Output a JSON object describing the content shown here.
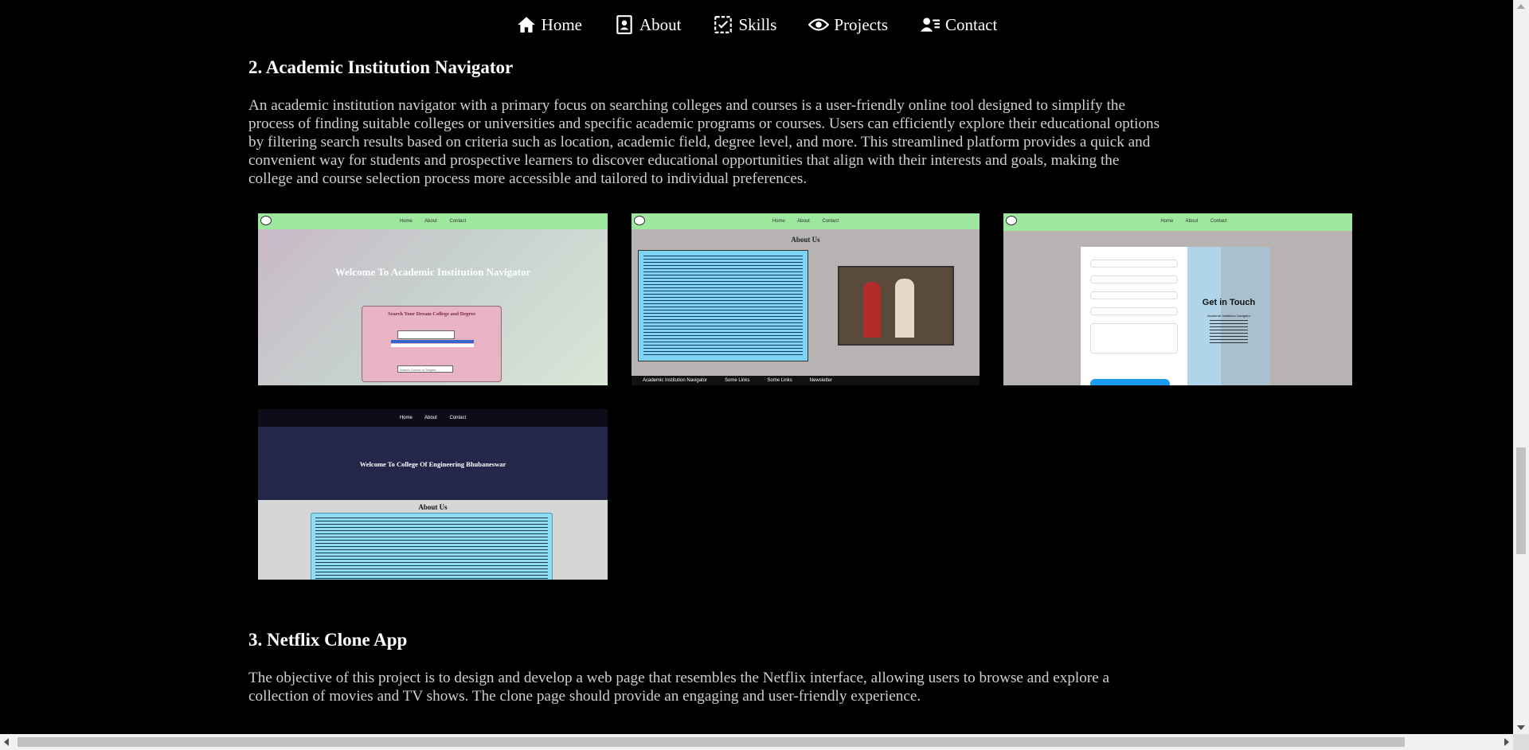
{
  "nav": {
    "items": [
      {
        "label": "Home",
        "icon": "home-icon"
      },
      {
        "label": "About",
        "icon": "contact-card-icon"
      },
      {
        "label": "Skills",
        "icon": "checklist-icon"
      },
      {
        "label": "Projects",
        "icon": "eye-icon"
      },
      {
        "label": "Contact",
        "icon": "contact-list-icon"
      }
    ]
  },
  "projects": {
    "p2": {
      "title": "2. Academic Institution Navigator",
      "description": "An academic institution navigator with a primary focus on searching colleges and courses is a user-friendly online tool designed to simplify the process of finding suitable colleges or universities and specific academic programs or courses. Users can efficiently explore their educational options by filtering search results based on criteria such as location, academic field, degree level, and more. This streamlined platform provides a quick and convenient way for students and prospective learners to discover educational opportunities that align with their interests and goals, making the college and course selection process more accessible and tailored to individual preferences.",
      "shots": {
        "s1": {
          "nav": "Home About Contact",
          "heading": "Welcome To Academic Institution Navigator",
          "search_title": "Search Your Dream College and Degree",
          "search2_placeholder": "Search Course or Degree"
        },
        "s2": {
          "nav": "Home About Contact",
          "heading": "About Us",
          "footer": [
            "Academic Institution Navigator",
            "Some Links",
            "Some Links",
            "Newsletter"
          ]
        },
        "s3": {
          "nav": "Home About Contact",
          "heading": "Get in Touch",
          "sub": "Academic Institution Navigator"
        },
        "s4": {
          "nav": "Home About Contact",
          "heading": "Welcome To College Of Engineering Bhubaneswar",
          "about": "About Us"
        }
      }
    },
    "p3": {
      "title": "3. Netflix Clone App",
      "description": "The objective of this project is to design and develop a web page that resembles the Netflix interface, allowing users to browse and explore a collection of movies and TV shows. The clone page should provide an engaging and user-friendly experience."
    }
  },
  "colors": {
    "background": "#000000",
    "text": "#ffffff",
    "description_text": "#cfcfcf",
    "shot_nav_green": "#9ee79e"
  }
}
